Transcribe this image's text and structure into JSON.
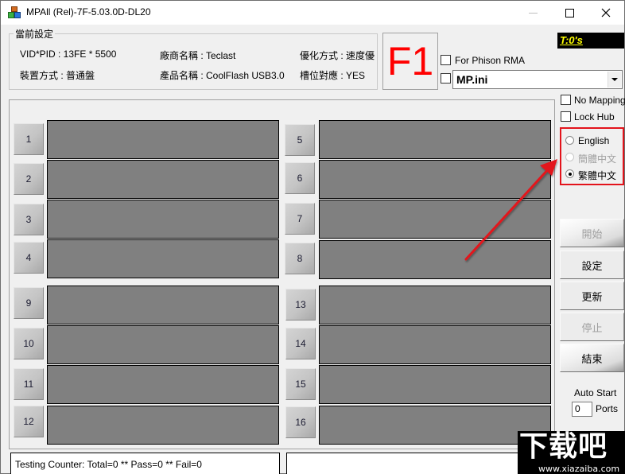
{
  "window": {
    "title": "MPAll (Rel)-7F-5.03.0D-DL20",
    "controls": [
      "minimize",
      "maximize",
      "close"
    ]
  },
  "settings": {
    "group_label": "當前設定",
    "vid_pid": "VID*PID : 13FE * 5500",
    "vendor": "廠商名稱 : Teclast",
    "optimize": "優化方式 : 速度優",
    "device_mode": "裝置方式 : 普通盤",
    "product": "產品名稱 : CoolFlash USB3.0",
    "slot_mapping": "槽位對應 : YES"
  },
  "f1_label": "F1",
  "timer": "T:0's",
  "options": {
    "for_phison_rma": {
      "label": "For Phison RMA",
      "checked": false
    },
    "ini_enable": {
      "checked": false
    },
    "ini_file": "MP.ini",
    "no_mapping": {
      "label": "No Mapping",
      "checked": false
    },
    "lock_hub": {
      "label": "Lock Hub",
      "checked": false
    }
  },
  "language": {
    "options": [
      {
        "label": "English",
        "selected": false,
        "enabled": true
      },
      {
        "label": "簡體中文",
        "selected": false,
        "enabled": false
      },
      {
        "label": "繁體中文",
        "selected": true,
        "enabled": true
      }
    ],
    "highlight_color": "#e3131b"
  },
  "ports": {
    "left": [
      "1",
      "2",
      "3",
      "4",
      "9",
      "10",
      "11",
      "12"
    ],
    "right": [
      "5",
      "6",
      "7",
      "8",
      "13",
      "14",
      "15",
      "16"
    ]
  },
  "actions": {
    "start": {
      "label": "開始",
      "enabled": false
    },
    "settings": {
      "label": "設定",
      "enabled": true
    },
    "refresh": {
      "label": "更新",
      "enabled": true
    },
    "stop": {
      "label": "停止",
      "enabled": false
    },
    "exit": {
      "label": "結束",
      "enabled": true
    }
  },
  "auto_start": {
    "label": "Auto Start",
    "value": "0",
    "unit": "Ports"
  },
  "status": {
    "counter": "Testing Counter: Total=0 ** Pass=0 ** Fail=0",
    "message": ""
  },
  "watermark": {
    "text": "下载吧",
    "url": "www.xiazaiba.com"
  },
  "colors": {
    "slot_panel": "#808080",
    "f1": "#ff0000",
    "timer_bg": "#000000",
    "timer_fg": "#ffff00",
    "annotation_arrow": "#e3131b"
  }
}
